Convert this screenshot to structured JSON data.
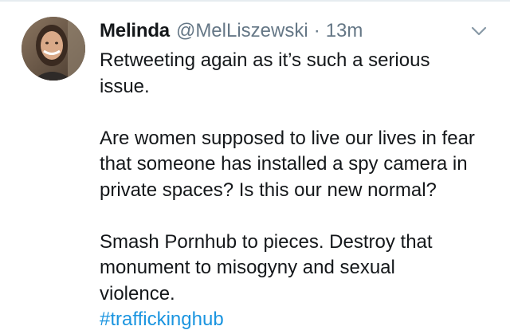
{
  "tweet": {
    "author_name": "Melinda",
    "author_handle": "@MelLiszewski",
    "separator": "·",
    "timestamp": "13m",
    "paragraphs": [
      "Retweeting again as it’s such a serious\nissue.",
      "Are women supposed to live our lives in fear\nthat someone has installed a spy camera in\nprivate spaces? Is this our new normal?",
      "Smash Pornhub to pieces. Destroy that\nmonument to misogyny and sexual\nviolence."
    ],
    "hashtag": "#traffickinghub"
  },
  "colors": {
    "text_primary": "#14171a",
    "text_secondary": "#657786",
    "link": "#1b95e0",
    "divider": "#e6ecf0"
  },
  "icons": {
    "menu": "chevron-down-icon",
    "avatar": "profile-photo"
  }
}
